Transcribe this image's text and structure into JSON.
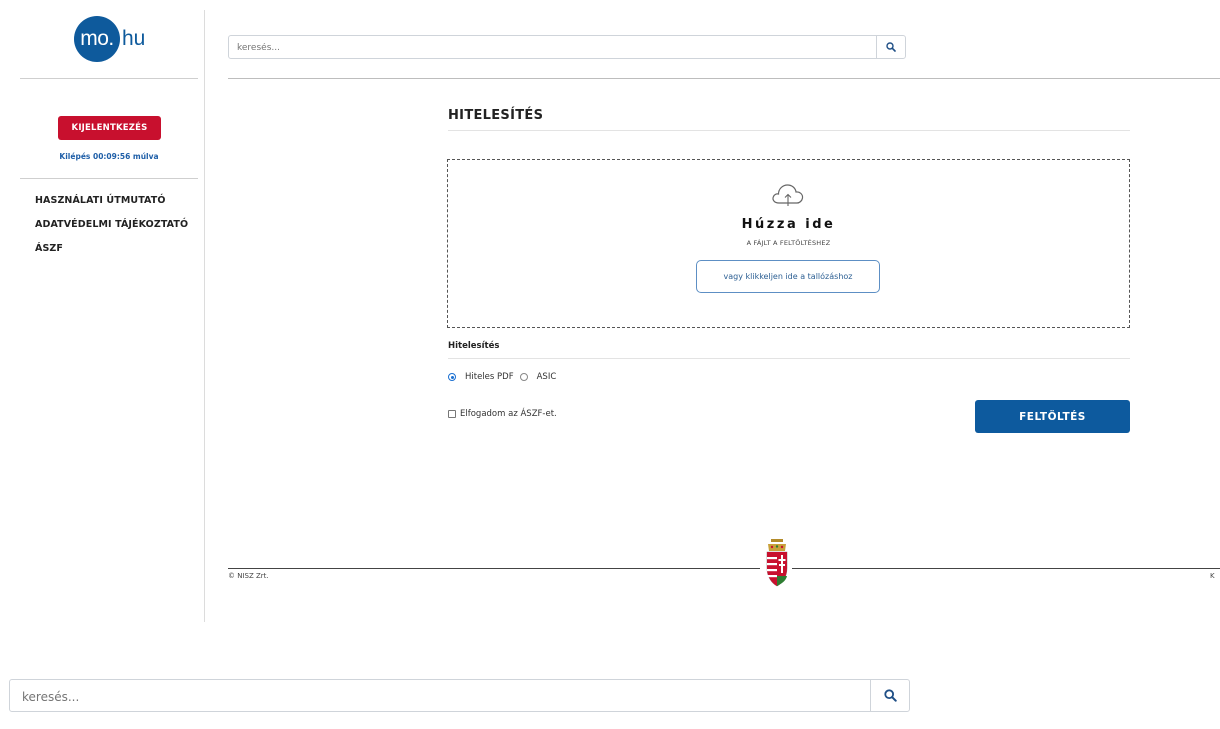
{
  "brand": {
    "logo_circle_text": "mo.",
    "logo_suffix_text": "hu",
    "primary_color": "#0e5a9c"
  },
  "sidebar": {
    "logout_label": "KIJELENTKEZÉS",
    "logout_color": "#c8102e",
    "logout_timer": "Kilépés 00:09:56 múlva",
    "items": [
      {
        "label": "HASZNÁLATI ÚTMUTATÓ"
      },
      {
        "label": "ADATVÉDELMI TÁJÉKOZTATÓ"
      },
      {
        "label": "ÁSZF"
      }
    ]
  },
  "search": {
    "placeholder": "keresés..."
  },
  "search_bottom": {
    "placeholder": "keresés..."
  },
  "main": {
    "title": "HITELESÍTÉS",
    "dropzone": {
      "title": "Húzza ide",
      "subtitle": "A FÁJLT A FELTÖLTÉSHEZ",
      "browse_label": "vagy klikkeljen ide a tallózáshoz"
    },
    "section_label": "Hitelesítés",
    "options": [
      {
        "label": "Hiteles PDF",
        "checked": true
      },
      {
        "label": "ASIC",
        "checked": false
      }
    ],
    "accept_label": "Elfogadom az ÁSZF-et.",
    "upload_label": "FELTÖLTÉS"
  },
  "footer": {
    "copyright": "© NISZ Zrt.",
    "right_text": "K"
  }
}
